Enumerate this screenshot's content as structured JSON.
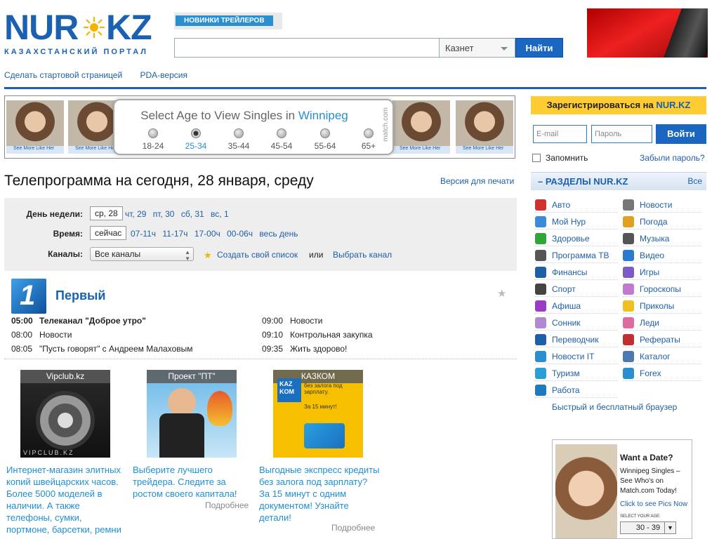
{
  "header": {
    "logo_main": "NUR",
    "logo_kz": "KZ",
    "logo_sub": "КАЗАХСТАНСКИЙ ПОРТАЛ",
    "trailers_tab": "НОВИНКИ ТРЕЙЛЕРОВ",
    "search_value": "",
    "search_scope": "Казнет",
    "search_button": "Найти",
    "links": [
      "Сделать стартовой страницей",
      "PDA-версия"
    ]
  },
  "match_ad": {
    "title_prefix": "Select Age to View Singles in ",
    "city": "Winnipeg",
    "ages": [
      "18-24",
      "25-34",
      "35-44",
      "45-54",
      "55-64",
      "65+"
    ],
    "selected_age": "25-34",
    "photo_caption": "See More Like Her",
    "brand": "match.com"
  },
  "tv": {
    "title": "Телепрограмма на сегодня, 28 января, среду",
    "print_link": "Версия для печати",
    "day_label": "День недели:",
    "day_current": "ср, 28",
    "days": [
      "чт, 29",
      "пт, 30",
      "сб, 31",
      "вс, 1"
    ],
    "time_label": "Время:",
    "time_current": "сейчас",
    "times": [
      "07-11ч",
      "11-17ч",
      "17-00ч",
      "00-06ч",
      "весь день"
    ],
    "channels_label": "Каналы:",
    "channels_value": "Все каналы",
    "create_list": "Создать свой список",
    "or": "или",
    "choose_channel": "Выбрать канал",
    "channel": {
      "logo": "1",
      "name": "Первый",
      "left": [
        {
          "time": "05:00",
          "title": "Телеканал \"Доброе утро\"",
          "now": true
        },
        {
          "time": "08:00",
          "title": "Новости",
          "now": false
        },
        {
          "time": "08:05",
          "title": "\"Пусть говорят\" с Андреем Малаховым",
          "now": false
        }
      ],
      "right": [
        {
          "time": "09:00",
          "title": "Новости"
        },
        {
          "time": "09:10",
          "title": "Контрольная закупка"
        },
        {
          "time": "09:35",
          "title": "Жить здорово!"
        }
      ]
    }
  },
  "promos": [
    {
      "head": "Vipclub.kz",
      "text": "Интернет-магазин элитных копий швейцарских часов. Более 5000 моделей в наличии. А также телефоны, сумки, портмоне, барсетки, ремни и многое другое по самым",
      "more": ""
    },
    {
      "head": "Проект \"ПТ\"",
      "text": "Выберите лучшего трейдера. Следите за ростом своего капитала!",
      "more": "Подробнее"
    },
    {
      "head": "КАЗКОМ",
      "text": "Выгодные экспресс кредиты без залога под зарплату? За 15 минут с одним документом! Узнайте детали!",
      "more": "Подробнее"
    }
  ],
  "promo_img_text": {
    "vip": "VIPCLUB.KZ",
    "kazkom_logo": "KAZ KOM",
    "kazkom_line1": "без залога под зарплату.",
    "kazkom_line2": "За 15 минут!"
  },
  "right": {
    "register_prefix": "Зарегистрироваться на ",
    "register_site": "NUR.KZ",
    "email_placeholder": "E-mail",
    "password_placeholder": "Пароль",
    "login_button": "Войти",
    "remember": "Запомнить",
    "forgot": "Забыли пароль?",
    "sections_title": "–  РАЗДЕЛЫ NUR.KZ",
    "sections_all": "Все",
    "sections_left": [
      {
        "label": "Авто",
        "icon": "car-icon",
        "color": "#d23030"
      },
      {
        "label": "Мой Нур",
        "icon": "user-icon",
        "color": "#3b8bd6"
      },
      {
        "label": "Здоровье",
        "icon": "health-cross-icon",
        "color": "#2fa53a"
      },
      {
        "label": "Программа ТВ",
        "icon": "tv-icon",
        "color": "#555555"
      },
      {
        "label": "Финансы",
        "icon": "tenge-icon",
        "color": "#1f5fa8"
      },
      {
        "label": "Спорт",
        "icon": "soccer-ball-icon",
        "color": "#444444"
      },
      {
        "label": "Афиша",
        "icon": "theater-mask-icon",
        "color": "#9a3cc4"
      },
      {
        "label": "Сонник",
        "icon": "moon-icon",
        "color": "#b08ad0"
      },
      {
        "label": "Переводчик",
        "icon": "eng-icon",
        "color": "#1f5fa8"
      },
      {
        "label": "Новости IT",
        "icon": "it-icon",
        "color": "#2a8fd0"
      },
      {
        "label": "Туризм",
        "icon": "flag-icon",
        "color": "#2a9fd6"
      },
      {
        "label": "Работа",
        "icon": "briefcase-icon",
        "color": "#1f7ac0"
      },
      {
        "label": "Быстрый и бесплатный браузер",
        "icon": "",
        "color": ""
      }
    ],
    "sections_right": [
      {
        "label": "Новости",
        "icon": "newspaper-icon",
        "color": "#777777"
      },
      {
        "label": "Погода",
        "icon": "weather-icon",
        "color": "#e0a020"
      },
      {
        "label": "Музыка",
        "icon": "headphones-icon",
        "color": "#555555"
      },
      {
        "label": "Видео",
        "icon": "video-play-icon",
        "color": "#2a7bcf"
      },
      {
        "label": "Игры",
        "icon": "game-icon",
        "color": "#7a5bc8"
      },
      {
        "label": "Гороскопы",
        "icon": "zodiac-icon",
        "color": "#c07ad0"
      },
      {
        "label": "Приколы",
        "icon": "smiley-icon",
        "color": "#f0c020"
      },
      {
        "label": "Леди",
        "icon": "lady-icon",
        "color": "#e06aa0"
      },
      {
        "label": "Рефераты",
        "icon": "books-icon",
        "color": "#c03030"
      },
      {
        "label": "Каталог",
        "icon": "catalog-icon",
        "color": "#4a7ab0"
      },
      {
        "label": "Forex",
        "icon": "forex-chart-icon",
        "color": "#2a8fd0"
      }
    ]
  },
  "date_ad": {
    "head": "Want a Date?",
    "text": "Winnipeg Singles – See Who's on Match.com Today!",
    "link": "Click to see Pics Now",
    "select_label": "SELECT YOUR AGE:",
    "select_value": "30 - 39"
  }
}
